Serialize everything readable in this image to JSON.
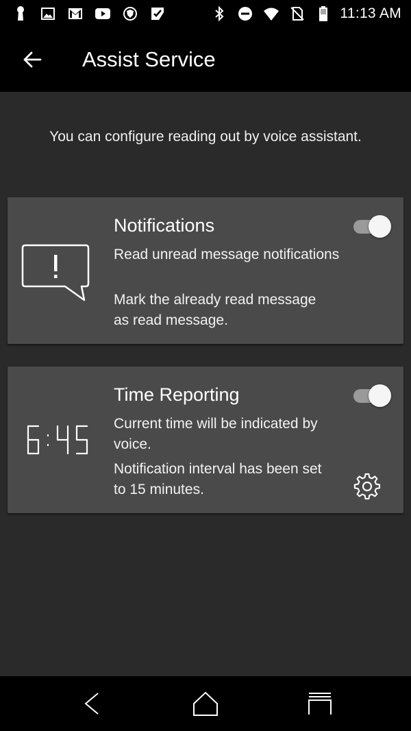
{
  "status_bar": {
    "time": "11:13 AM",
    "left_icons": [
      "keyhole-icon",
      "image-icon",
      "gmail-icon",
      "youtube-icon",
      "shield-icon",
      "task-check-icon"
    ],
    "right_icons": [
      "bluetooth-icon",
      "do-not-disturb-icon",
      "wifi-icon",
      "no-sim-icon",
      "battery-icon"
    ]
  },
  "app_bar": {
    "title": "Assist Service"
  },
  "intro_text": "You can configure reading out by voice assistant.",
  "cards": {
    "notifications": {
      "title": "Notifications",
      "description_1": "Read unread message notifications",
      "description_2": "Mark the already read message as read message.",
      "enabled": true,
      "icon": "chat-alert-icon"
    },
    "time_reporting": {
      "title": "Time Reporting",
      "description_1": "Current time will be indicated by voice.",
      "description_2": "Notification interval has been set to 15 minutes.",
      "enabled": true,
      "icon_text": "6:45",
      "icon": "digital-clock-icon"
    }
  },
  "colors": {
    "background": "#2a2a2a",
    "card": "#4a4a4a",
    "bar": "#000000",
    "toggle_thumb": "#f5f5f5",
    "toggle_track": "#9a9a9a"
  }
}
